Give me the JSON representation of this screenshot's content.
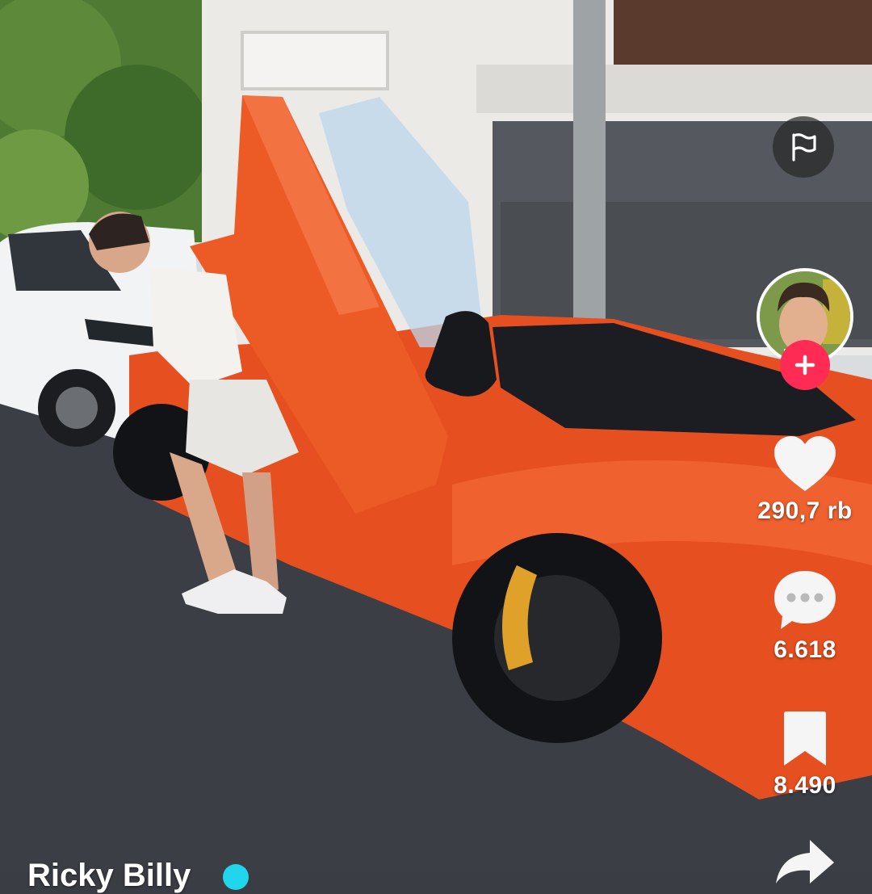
{
  "video": {
    "description": "Street scene: man opening scissor door of orange sports car, white van behind"
  },
  "report": {
    "icon": "flag-icon"
  },
  "creator": {
    "avatar_icon": "avatar",
    "follow_icon": "plus-icon"
  },
  "actions": {
    "like": {
      "icon": "heart-icon",
      "count": "290,7 rb"
    },
    "comment": {
      "icon": "comment-icon",
      "count": "6.618"
    },
    "save": {
      "icon": "bookmark-icon",
      "count": "8.490"
    },
    "share": {
      "icon": "share-icon"
    }
  },
  "author": {
    "username": "Ricky Billy"
  },
  "colors": {
    "follow": "#fe2c55",
    "verified": "#20d5ec",
    "car": "#e8501e"
  }
}
